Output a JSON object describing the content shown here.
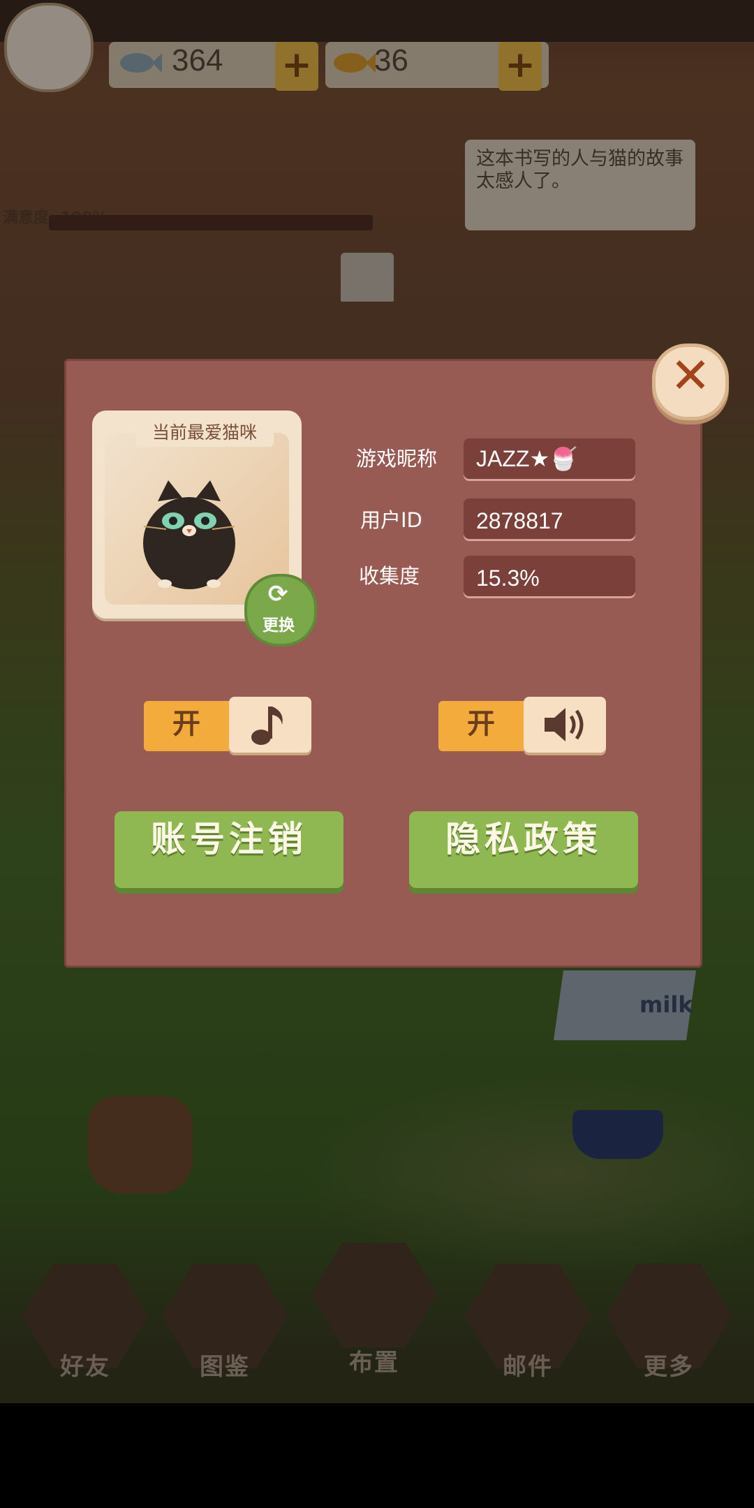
{
  "hud": {
    "currency_silver": "364",
    "currency_gold": "36",
    "plus": "+",
    "satisfaction": "满意度: 100%"
  },
  "background": {
    "speech_bubble": "这本书写的人与猫的故事太感人了。",
    "milk_label": "milk"
  },
  "profile_dialog": {
    "close": "✕",
    "favorite_cat_title": "当前最爱猫咪",
    "swap_label": "更换",
    "nickname_label": "游戏昵称",
    "nickname_value": "JAZZ★🍧",
    "user_id_label": "用户ID",
    "user_id_value": "2878817",
    "collection_label": "收集度",
    "collection_value": "15.3%",
    "music_toggle": "开",
    "sound_toggle": "开",
    "delete_account_button": "账号注销",
    "privacy_policy_button": "隐私政策"
  },
  "bottom_nav": [
    "好友",
    "图鉴",
    "布置",
    "邮件",
    "更多"
  ],
  "icons": {
    "music": "music-note-icon",
    "sound": "speaker-icon",
    "close": "close-icon",
    "swap": "refresh-icon"
  },
  "colors": {
    "dialog_bg": "#985b53",
    "green_button": "#8fb852",
    "toggle_on": "#f3ab3c"
  }
}
